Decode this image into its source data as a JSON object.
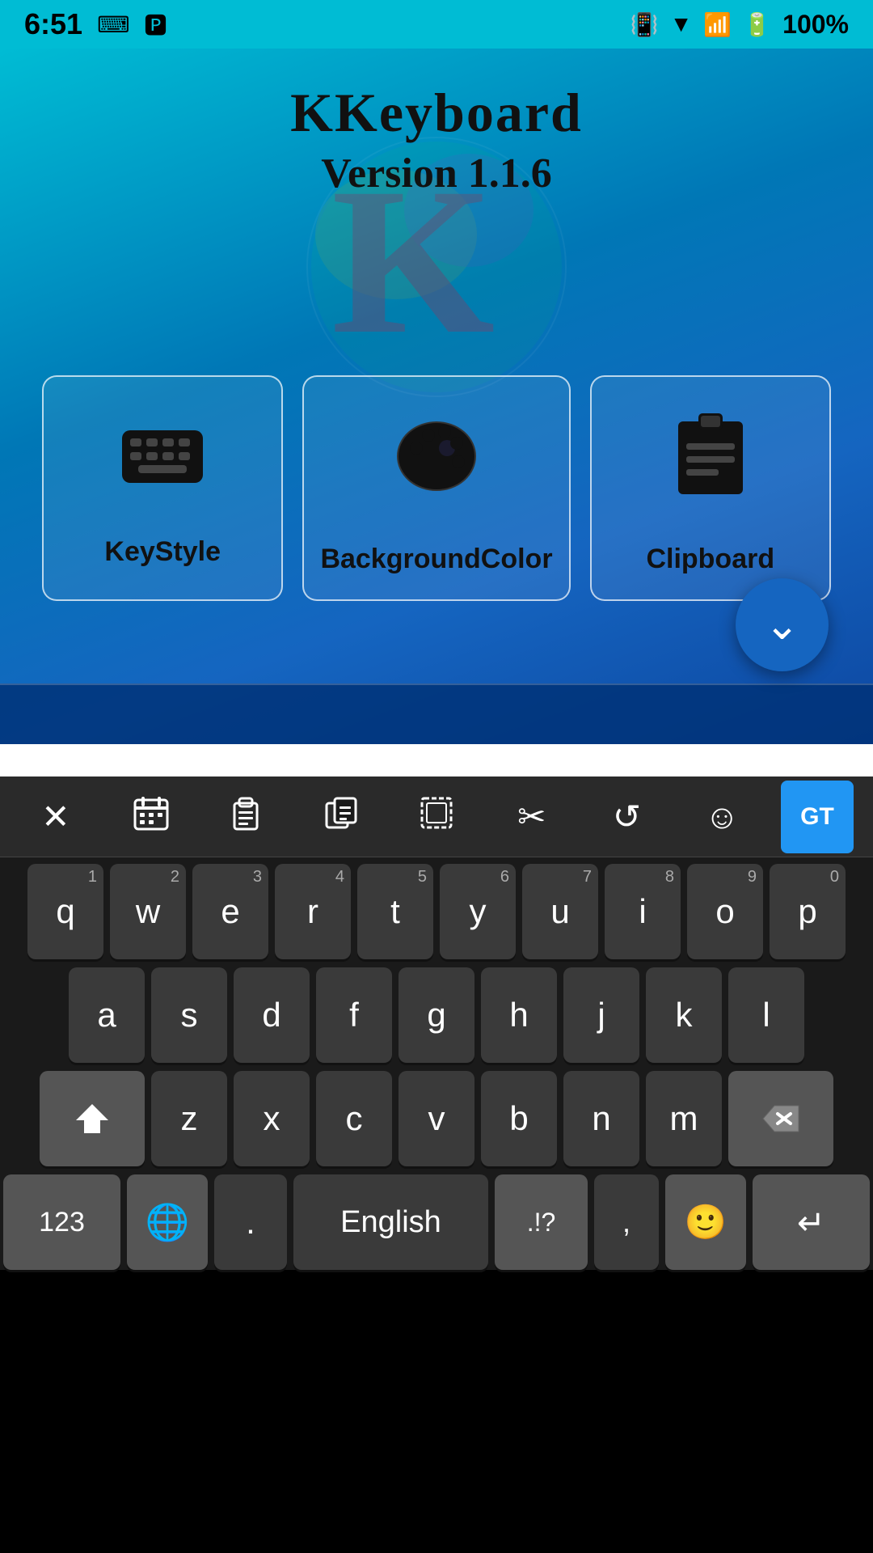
{
  "statusBar": {
    "time": "6:51",
    "battery": "100%"
  },
  "app": {
    "title": "KKeyboard",
    "version": "Version 1.1.6"
  },
  "cards": [
    {
      "id": "keystyle",
      "label": "KeyStyle",
      "icon": "⌨"
    },
    {
      "id": "backgroundcolor",
      "label": "BackgroundColor",
      "icon": "🎨"
    },
    {
      "id": "clipboard",
      "label": "Clipboard",
      "icon": "📋"
    }
  ],
  "toolbar": {
    "buttons": [
      {
        "id": "close",
        "icon": "✕"
      },
      {
        "id": "calendar",
        "icon": "📅"
      },
      {
        "id": "paste",
        "icon": "📋"
      },
      {
        "id": "copy",
        "icon": "⧉"
      },
      {
        "id": "select",
        "icon": "⬚"
      },
      {
        "id": "cut",
        "icon": "✂"
      },
      {
        "id": "rotate",
        "icon": "↺"
      },
      {
        "id": "emoji",
        "icon": "☺"
      },
      {
        "id": "translate",
        "icon": "GT"
      }
    ]
  },
  "keyboard": {
    "rows": [
      {
        "keys": [
          {
            "char": "q",
            "num": "1"
          },
          {
            "char": "w",
            "num": "2"
          },
          {
            "char": "e",
            "num": "3"
          },
          {
            "char": "r",
            "num": "4"
          },
          {
            "char": "t",
            "num": "5"
          },
          {
            "char": "y",
            "num": "6"
          },
          {
            "char": "u",
            "num": "7"
          },
          {
            "char": "i",
            "num": "8"
          },
          {
            "char": "o",
            "num": "9"
          },
          {
            "char": "p",
            "num": "0"
          }
        ]
      },
      {
        "keys": [
          {
            "char": "a"
          },
          {
            "char": "s"
          },
          {
            "char": "d"
          },
          {
            "char": "f"
          },
          {
            "char": "g"
          },
          {
            "char": "h"
          },
          {
            "char": "j"
          },
          {
            "char": "k"
          },
          {
            "char": "l"
          }
        ]
      },
      {
        "keys": [
          {
            "char": "z"
          },
          {
            "char": "x"
          },
          {
            "char": "c"
          },
          {
            "char": "v"
          },
          {
            "char": "b"
          },
          {
            "char": "n"
          },
          {
            "char": "m"
          }
        ]
      }
    ],
    "bottomRow": {
      "numbers": "123",
      "globe": "🌐",
      "period": ".",
      "spaceLabel": "English",
      "symbolsLabel": ".!?",
      "comma": ",",
      "enterIcon": "↵"
    }
  },
  "floatingButton": {
    "icon": "⌄"
  }
}
